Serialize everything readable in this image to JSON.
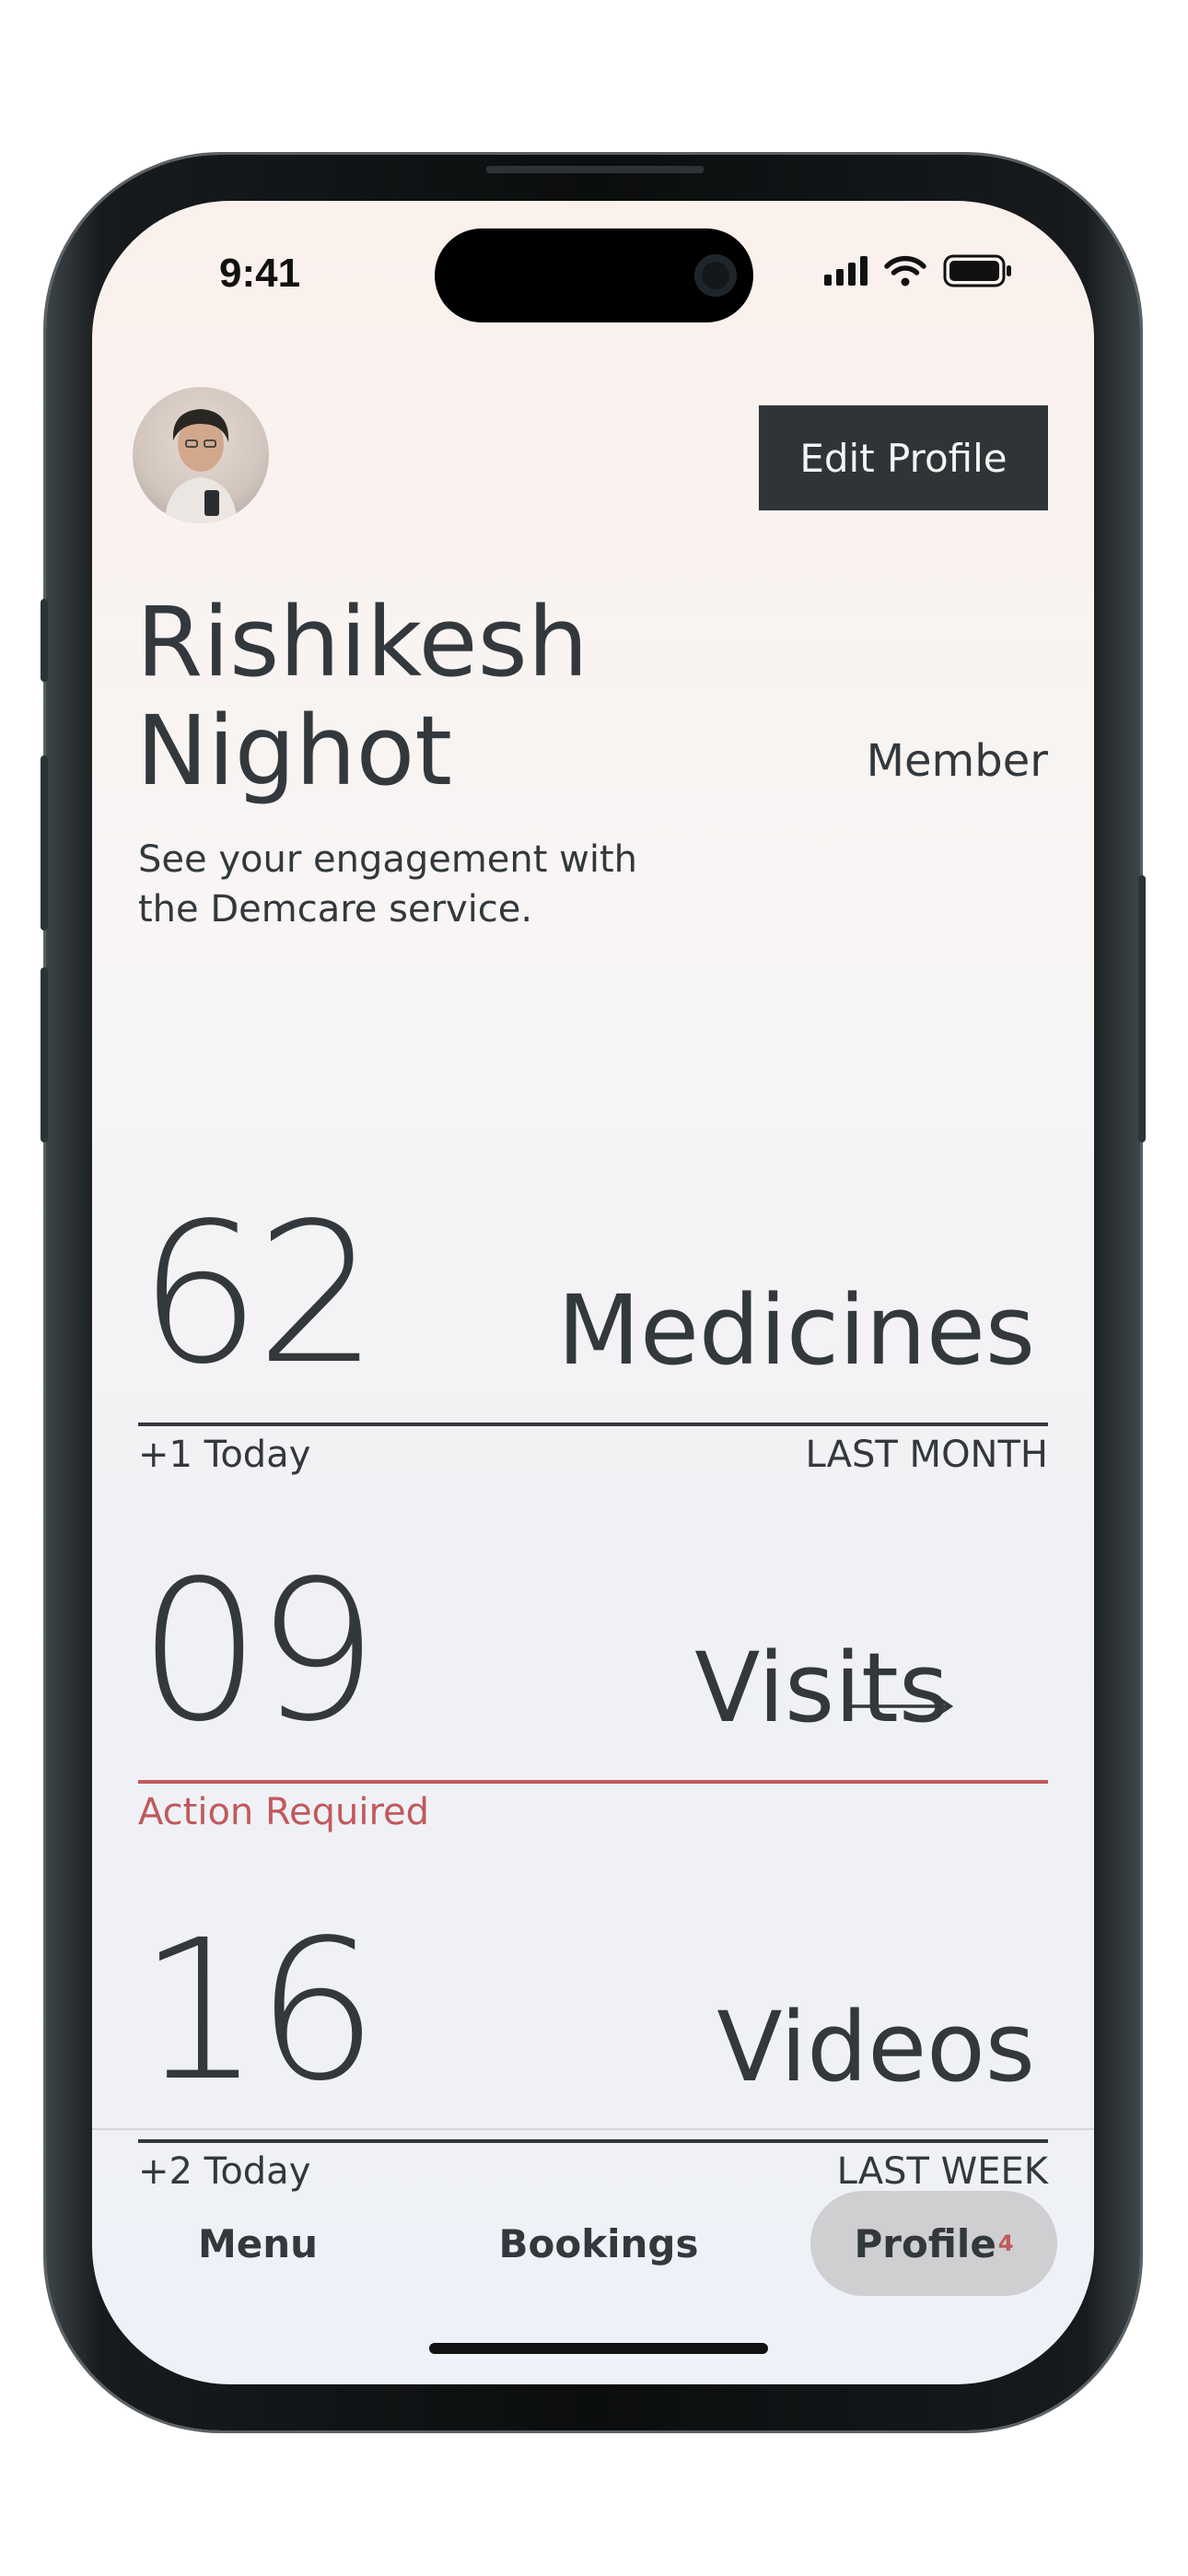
{
  "status_bar": {
    "time": "9:41"
  },
  "header": {
    "edit_button": "Edit Profile",
    "first_name": "Rishikesh",
    "last_name": "Nighot",
    "role": "Member",
    "subtitle_line1": "See your engagement with",
    "subtitle_line2": "the Demcare service."
  },
  "stats": [
    {
      "value": "62",
      "label": "Medicines",
      "left_note": "+1 Today",
      "right_note": "LAST MONTH"
    },
    {
      "value": "09",
      "label": "Visits",
      "left_note": "Action Required",
      "right_note": ""
    },
    {
      "value": "16",
      "label": "Videos",
      "left_note": "+2 Today",
      "right_note": "LAST WEEK"
    }
  ],
  "tabs": {
    "menu": "Menu",
    "bookings": "Bookings",
    "profile": "Profile",
    "profile_badge": "4"
  },
  "colors": {
    "text": "#33383c",
    "alert": "#c05a5c",
    "button_bg": "#2f3437",
    "active_tab_bg": "#cfcfd1"
  },
  "icons": [
    "cellular-signal-icon",
    "wifi-icon",
    "battery-icon",
    "arrow-right-icon"
  ]
}
